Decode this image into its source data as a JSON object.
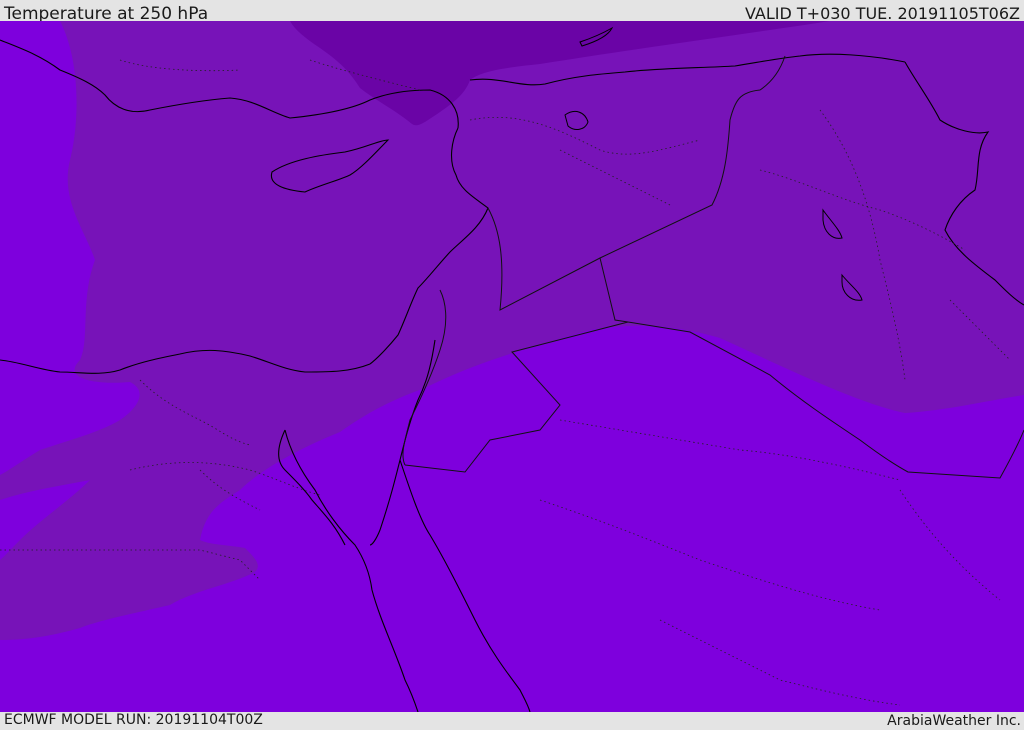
{
  "header": {
    "title": "Temperature at 250 hPa",
    "valid": "VALID T+030 TUE. 20191105T06Z"
  },
  "footer": {
    "model_run": "ECMWF MODEL RUN: 20191104T00Z",
    "credit": "ArabiaWeather Inc."
  },
  "map": {
    "field": "temperature-250hpa",
    "colors": {
      "warm_band": "#7e00dd",
      "mid_band": "#7713b8",
      "cold_band": "#6a04a6",
      "coastline": "#000000",
      "border": "#111111"
    }
  }
}
